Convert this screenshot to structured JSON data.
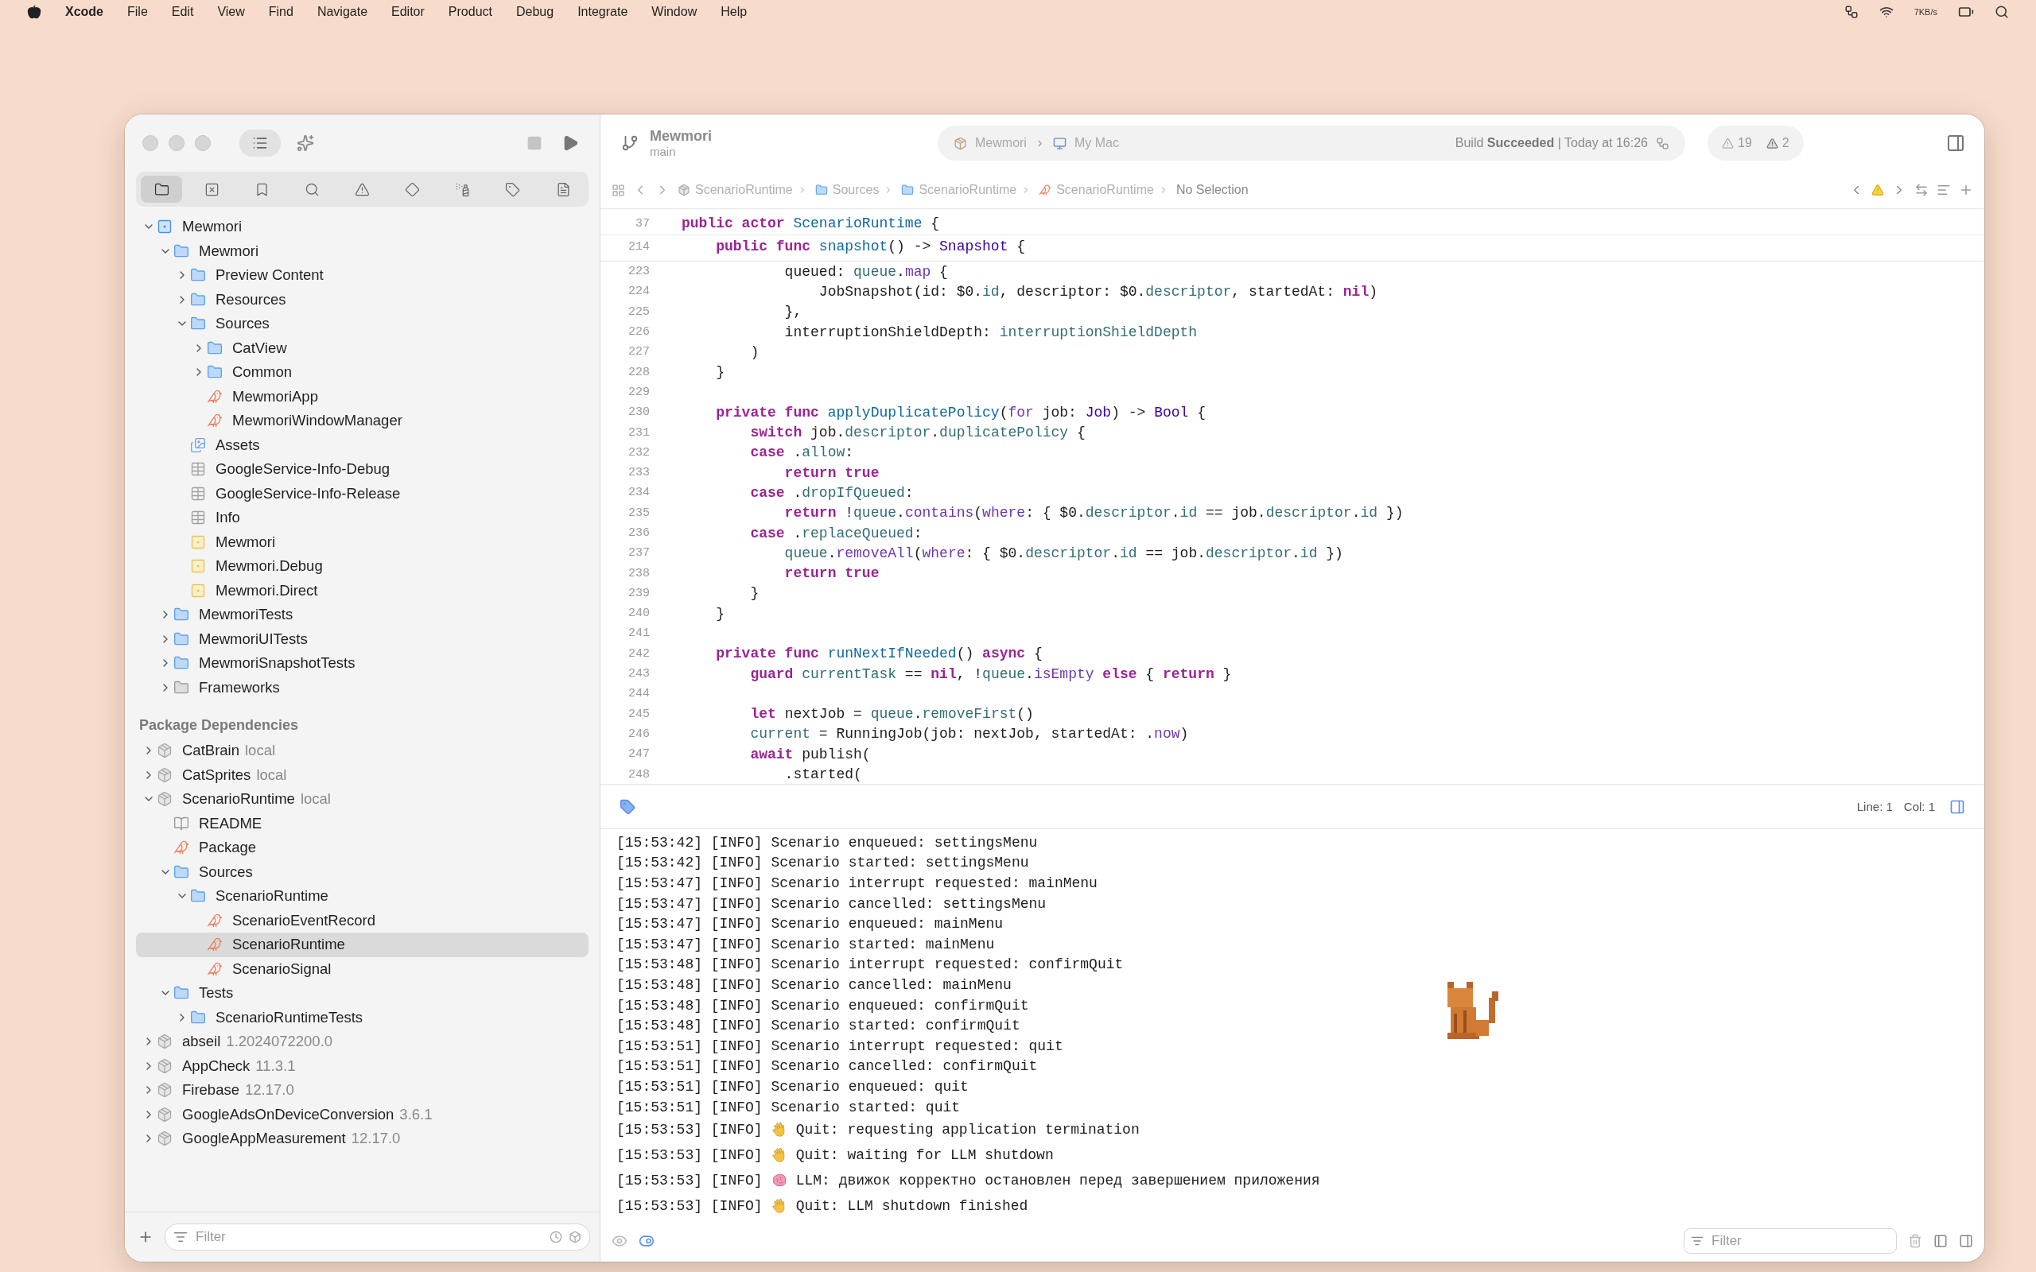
{
  "menu_bar": {
    "app": "Xcode",
    "menus": [
      "File",
      "Edit",
      "View",
      "Find",
      "Navigate",
      "Editor",
      "Product",
      "Debug",
      "Integrate",
      "Window",
      "Help"
    ],
    "network_speed": "7KB/s"
  },
  "toolbar": {
    "scheme": {
      "name": "Mewmori",
      "branch": "main"
    },
    "run_destination": {
      "target": "Mewmori",
      "device": "My Mac"
    },
    "status": "Build **Succeeded** | Today at 16:26",
    "warning_count": "19",
    "issue_count": "2"
  },
  "navigator": {
    "tabs": [
      {
        "kind": "folder",
        "selected": true
      },
      {
        "kind": "source-control",
        "selected": false
      },
      {
        "kind": "bookmark",
        "selected": false
      },
      {
        "kind": "search",
        "selected": false
      },
      {
        "kind": "issue",
        "selected": false
      },
      {
        "kind": "test",
        "selected": false
      },
      {
        "kind": "debug",
        "selected": false
      },
      {
        "kind": "breakpoint",
        "selected": false
      },
      {
        "kind": "report",
        "selected": false
      }
    ],
    "tree": [
      {
        "label": "Mewmori",
        "kind": "project",
        "expanded": true,
        "selected": false,
        "children": [
          {
            "label": "Mewmori",
            "kind": "folder",
            "expanded": true,
            "selected": false,
            "children": [
              {
                "label": "Preview Content",
                "kind": "folder",
                "expanded": false,
                "selected": false
              },
              {
                "label": "Resources",
                "kind": "folder",
                "expanded": false,
                "selected": false
              },
              {
                "label": "Sources",
                "kind": "folder",
                "expanded": true,
                "selected": false,
                "children": [
                  {
                    "label": "CatView",
                    "kind": "folder",
                    "expanded": false,
                    "selected": false
                  },
                  {
                    "label": "Common",
                    "kind": "folder",
                    "expanded": false,
                    "selected": false
                  },
                  {
                    "label": "MewmoriApp",
                    "kind": "swift",
                    "selected": false
                  },
                  {
                    "label": "MewmoriWindowManager",
                    "kind": "swift",
                    "selected": false
                  }
                ]
              },
              {
                "label": "Assets",
                "kind": "assets",
                "selected": false
              },
              {
                "label": "GoogleService-Info-Debug",
                "kind": "plist",
                "selected": false
              },
              {
                "label": "GoogleService-Info-Release",
                "kind": "plist",
                "selected": false
              },
              {
                "label": "Info",
                "kind": "plist",
                "selected": false
              },
              {
                "label": "Mewmori",
                "kind": "config",
                "selected": false
              },
              {
                "label": "Mewmori.Debug",
                "kind": "config",
                "selected": false
              },
              {
                "label": "Mewmori.Direct",
                "kind": "config",
                "selected": false
              }
            ]
          },
          {
            "label": "MewmoriTests",
            "kind": "folder",
            "expanded": false,
            "selected": false
          },
          {
            "label": "MewmoriUITests",
            "kind": "folder",
            "expanded": false,
            "selected": false
          },
          {
            "label": "MewmoriSnapshotTests",
            "kind": "folder",
            "expanded": false,
            "selected": false
          },
          {
            "label": "Frameworks",
            "kind": "frameworks",
            "expanded": false,
            "selected": false
          }
        ]
      }
    ],
    "packages_heading": "Package Dependencies",
    "packages": [
      {
        "label": "CatBrain",
        "suffix": "local",
        "kind": "package",
        "expanded": false,
        "selected": false
      },
      {
        "label": "CatSprites",
        "suffix": "local",
        "kind": "package",
        "expanded": false,
        "selected": false
      },
      {
        "label": "ScenarioRuntime",
        "suffix": "local",
        "kind": "package",
        "expanded": true,
        "selected": false,
        "children": [
          {
            "label": "README",
            "kind": "book",
            "selected": false
          },
          {
            "label": "Package",
            "kind": "swift",
            "selected": false
          },
          {
            "label": "Sources",
            "kind": "folder",
            "expanded": true,
            "selected": false,
            "children": [
              {
                "label": "ScenarioRuntime",
                "kind": "folder",
                "expanded": true,
                "selected": false,
                "children": [
                  {
                    "label": "ScenarioEventRecord",
                    "kind": "swift",
                    "selected": false
                  },
                  {
                    "label": "ScenarioRuntime",
                    "kind": "swift",
                    "selected": true
                  },
                  {
                    "label": "ScenarioSignal",
                    "kind": "swift",
                    "selected": false
                  }
                ]
              }
            ]
          },
          {
            "label": "Tests",
            "kind": "folder",
            "expanded": true,
            "selected": false,
            "children": [
              {
                "label": "ScenarioRuntimeTests",
                "kind": "folder",
                "expanded": false,
                "selected": false
              }
            ]
          }
        ]
      },
      {
        "label": "abseil",
        "suffix": "1.2024072200.0",
        "kind": "package",
        "expanded": false,
        "selected": false
      },
      {
        "label": "AppCheck",
        "suffix": "11.3.1",
        "kind": "package",
        "expanded": false,
        "selected": false
      },
      {
        "label": "Firebase",
        "suffix": "12.17.0",
        "kind": "package",
        "expanded": false,
        "selected": false
      },
      {
        "label": "GoogleAdsOnDeviceConversion",
        "suffix": "3.6.1",
        "kind": "package",
        "expanded": false,
        "selected": false
      },
      {
        "label": "GoogleAppMeasurement",
        "suffix": "12.17.0",
        "kind": "package",
        "expanded": false,
        "selected": false
      }
    ],
    "filter": {
      "placeholder": "Filter"
    }
  },
  "jump_bar": {
    "path": [
      {
        "label": "ScenarioRuntime",
        "kind": "package"
      },
      {
        "label": "Sources",
        "kind": "folder"
      },
      {
        "label": "ScenarioRuntime",
        "kind": "folder"
      },
      {
        "label": "ScenarioRuntime",
        "kind": "swift"
      }
    ],
    "selection": "No Selection"
  },
  "editor": {
    "sticky_lines": [
      {
        "number": "37",
        "tokens": [
          {
            "text": "public actor ",
            "kind": "keyword"
          },
          {
            "text": "ScenarioRuntime",
            "kind": "name"
          },
          {
            "text": " {",
            "kind": "plain"
          }
        ]
      },
      {
        "number": "214",
        "tokens": [
          {
            "text": "    public func ",
            "kind": "keyword"
          },
          {
            "text": "snapshot",
            "kind": "name"
          },
          {
            "text": "() -> ",
            "kind": "plain"
          },
          {
            "text": "Snapshot",
            "kind": "type"
          },
          {
            "text": " {",
            "kind": "plain"
          }
        ]
      }
    ],
    "lines": [
      {
        "number": "223",
        "tokens": [
          {
            "text": "            queued: ",
            "kind": "plain"
          },
          {
            "text": "queue",
            "kind": "property"
          },
          {
            "text": ".",
            "kind": "plain"
          },
          {
            "text": "map",
            "kind": "method"
          },
          {
            "text": " {",
            "kind": "plain"
          }
        ]
      },
      {
        "number": "224",
        "tokens": [
          {
            "text": "                JobSnapshot(id: $0.",
            "kind": "plain"
          },
          {
            "text": "id",
            "kind": "property"
          },
          {
            "text": ", descriptor: $0.",
            "kind": "plain"
          },
          {
            "text": "descriptor",
            "kind": "property"
          },
          {
            "text": ", startedAt: ",
            "kind": "plain"
          },
          {
            "text": "nil",
            "kind": "keyword"
          },
          {
            "text": ")",
            "kind": "plain"
          }
        ]
      },
      {
        "number": "225",
        "tokens": [
          {
            "text": "            },",
            "kind": "plain"
          }
        ]
      },
      {
        "number": "226",
        "tokens": [
          {
            "text": "            interruptionShieldDepth: ",
            "kind": "plain"
          },
          {
            "text": "interruptionShieldDepth",
            "kind": "property"
          }
        ]
      },
      {
        "number": "227",
        "tokens": [
          {
            "text": "        )",
            "kind": "plain"
          }
        ]
      },
      {
        "number": "228",
        "tokens": [
          {
            "text": "    }",
            "kind": "plain"
          }
        ]
      },
      {
        "number": "229"
      },
      {
        "number": "230",
        "tokens": [
          {
            "text": "    private func ",
            "kind": "keyword"
          },
          {
            "text": "applyDuplicatePolicy",
            "kind": "name"
          },
          {
            "text": "(",
            "kind": "plain"
          },
          {
            "text": "for",
            "kind": "method"
          },
          {
            "text": " job: ",
            "kind": "plain"
          },
          {
            "text": "Job",
            "kind": "type"
          },
          {
            "text": ") -> ",
            "kind": "plain"
          },
          {
            "text": "Bool",
            "kind": "type"
          },
          {
            "text": " {",
            "kind": "plain"
          }
        ]
      },
      {
        "number": "231",
        "tokens": [
          {
            "text": "        switch",
            "kind": "keyword"
          },
          {
            "text": " job.",
            "kind": "plain"
          },
          {
            "text": "descriptor",
            "kind": "property"
          },
          {
            "text": ".",
            "kind": "plain"
          },
          {
            "text": "duplicatePolicy",
            "kind": "property"
          },
          {
            "text": " {",
            "kind": "plain"
          }
        ]
      },
      {
        "number": "232",
        "tokens": [
          {
            "text": "        case",
            "kind": "keyword"
          },
          {
            "text": " .",
            "kind": "plain"
          },
          {
            "text": "allow",
            "kind": "property"
          },
          {
            "text": ":",
            "kind": "plain"
          }
        ]
      },
      {
        "number": "233",
        "tokens": [
          {
            "text": "            return true",
            "kind": "keyword"
          }
        ]
      },
      {
        "number": "234",
        "tokens": [
          {
            "text": "        case",
            "kind": "keyword"
          },
          {
            "text": " .",
            "kind": "plain"
          },
          {
            "text": "dropIfQueued",
            "kind": "property"
          },
          {
            "text": ":",
            "kind": "plain"
          }
        ]
      },
      {
        "number": "235",
        "tokens": [
          {
            "text": "            return",
            "kind": "keyword"
          },
          {
            "text": " !",
            "kind": "plain"
          },
          {
            "text": "queue",
            "kind": "property"
          },
          {
            "text": ".",
            "kind": "plain"
          },
          {
            "text": "contains",
            "kind": "method"
          },
          {
            "text": "(",
            "kind": "plain"
          },
          {
            "text": "where",
            "kind": "method"
          },
          {
            "text": ": { $0.",
            "kind": "plain"
          },
          {
            "text": "descriptor",
            "kind": "property"
          },
          {
            "text": ".",
            "kind": "plain"
          },
          {
            "text": "id",
            "kind": "property"
          },
          {
            "text": " == job.",
            "kind": "plain"
          },
          {
            "text": "descriptor",
            "kind": "property"
          },
          {
            "text": ".",
            "kind": "plain"
          },
          {
            "text": "id",
            "kind": "property"
          },
          {
            "text": " })",
            "kind": "plain"
          }
        ]
      },
      {
        "number": "236",
        "tokens": [
          {
            "text": "        case",
            "kind": "keyword"
          },
          {
            "text": " .",
            "kind": "plain"
          },
          {
            "text": "replaceQueued",
            "kind": "property"
          },
          {
            "text": ":",
            "kind": "plain"
          }
        ]
      },
      {
        "number": "237",
        "tokens": [
          {
            "text": "            queue",
            "kind": "property"
          },
          {
            "text": ".",
            "kind": "plain"
          },
          {
            "text": "removeAll",
            "kind": "method"
          },
          {
            "text": "(",
            "kind": "plain"
          },
          {
            "text": "where",
            "kind": "method"
          },
          {
            "text": ": { $0.",
            "kind": "plain"
          },
          {
            "text": "descriptor",
            "kind": "property"
          },
          {
            "text": ".",
            "kind": "plain"
          },
          {
            "text": "id",
            "kind": "property"
          },
          {
            "text": " == job.",
            "kind": "plain"
          },
          {
            "text": "descriptor",
            "kind": "property"
          },
          {
            "text": ".",
            "kind": "plain"
          },
          {
            "text": "id",
            "kind": "property"
          },
          {
            "text": " })",
            "kind": "plain"
          }
        ]
      },
      {
        "number": "238",
        "tokens": [
          {
            "text": "            return true",
            "kind": "keyword"
          }
        ]
      },
      {
        "number": "239",
        "tokens": [
          {
            "text": "        }",
            "kind": "plain"
          }
        ]
      },
      {
        "number": "240",
        "tokens": [
          {
            "text": "    }",
            "kind": "plain"
          }
        ]
      },
      {
        "number": "241"
      },
      {
        "number": "242",
        "tokens": [
          {
            "text": "    private func ",
            "kind": "keyword"
          },
          {
            "text": "runNextIfNeeded",
            "kind": "name"
          },
          {
            "text": "() ",
            "kind": "plain"
          },
          {
            "text": "async",
            "kind": "keyword"
          },
          {
            "text": " {",
            "kind": "plain"
          }
        ]
      },
      {
        "number": "243",
        "tokens": [
          {
            "text": "        guard ",
            "kind": "keyword"
          },
          {
            "text": "currentTask",
            "kind": "property"
          },
          {
            "text": " == ",
            "kind": "plain"
          },
          {
            "text": "nil",
            "kind": "keyword"
          },
          {
            "text": ", !",
            "kind": "plain"
          },
          {
            "text": "queue",
            "kind": "property"
          },
          {
            "text": ".",
            "kind": "plain"
          },
          {
            "text": "isEmpty",
            "kind": "method"
          },
          {
            "text": " else",
            "kind": "keyword"
          },
          {
            "text": " { ",
            "kind": "plain"
          },
          {
            "text": "return",
            "kind": "keyword"
          },
          {
            "text": " }",
            "kind": "plain"
          }
        ]
      },
      {
        "number": "244"
      },
      {
        "number": "245",
        "tokens": [
          {
            "text": "        let ",
            "kind": "keyword"
          },
          {
            "text": "nextJob = ",
            "kind": "plain"
          },
          {
            "text": "queue",
            "kind": "property"
          },
          {
            "text": ".",
            "kind": "plain"
          },
          {
            "text": "removeFirst",
            "kind": "property"
          },
          {
            "text": "()",
            "kind": "plain"
          }
        ]
      },
      {
        "number": "246",
        "tokens": [
          {
            "text": "        current",
            "kind": "property"
          },
          {
            "text": " = RunningJob(job: nextJob, startedAt: .",
            "kind": "plain"
          },
          {
            "text": "now",
            "kind": "method"
          },
          {
            "text": ")",
            "kind": "plain"
          }
        ]
      },
      {
        "number": "247",
        "tokens": [
          {
            "text": "        await ",
            "kind": "keyword"
          },
          {
            "text": "publish(",
            "kind": "plain"
          }
        ]
      },
      {
        "number": "248",
        "tokens": [
          {
            "text": "            .started(",
            "kind": "plain"
          }
        ]
      }
    ]
  },
  "debug_bar": {
    "line": "Line: 1",
    "column": "Col: 1"
  },
  "console": {
    "lines": [
      {
        "kind": "log",
        "text": "[15:53:42] [INFO] Scenario enqueued: settingsMenu"
      },
      {
        "kind": "log",
        "text": "[15:53:42] [INFO] Scenario started: settingsMenu"
      },
      {
        "kind": "log",
        "text": "[15:53:47] [INFO] Scenario interrupt requested: mainMenu"
      },
      {
        "kind": "log",
        "text": "[15:53:47] [INFO] Scenario cancelled: settingsMenu"
      },
      {
        "kind": "log",
        "text": "[15:53:47] [INFO] Scenario enqueued: mainMenu"
      },
      {
        "kind": "log",
        "text": "[15:53:47] [INFO] Scenario started: mainMenu"
      },
      {
        "kind": "log",
        "text": "[15:53:48] [INFO] Scenario interrupt requested: confirmQuit"
      },
      {
        "kind": "log",
        "text": "[15:53:48] [INFO] Scenario cancelled: mainMenu"
      },
      {
        "kind": "log",
        "text": "[15:53:48] [INFO] Scenario enqueued: confirmQuit"
      },
      {
        "kind": "log",
        "text": "[15:53:48] [INFO] Scenario started: confirmQuit"
      },
      {
        "kind": "log",
        "text": "[15:53:51] [INFO] Scenario interrupt requested: quit"
      },
      {
        "kind": "log",
        "text": "[15:53:51] [INFO] Scenario cancelled: confirmQuit"
      },
      {
        "kind": "log",
        "text": "[15:53:51] [INFO] Scenario enqueued: quit"
      },
      {
        "kind": "log",
        "text": "[15:53:51] [INFO] Scenario started: quit"
      },
      {
        "kind": "wave",
        "prefix": "[15:53:53] [INFO]",
        "message": "Quit: requesting application termination"
      },
      {
        "kind": "wave",
        "prefix": "[15:53:53] [INFO]",
        "message": "Quit: waiting for LLM shutdown"
      },
      {
        "kind": "brain",
        "prefix": "[15:53:53] [INFO]",
        "message": "LLM: движок корректно остановлен перед завершением приложения"
      },
      {
        "kind": "wave",
        "prefix": "[15:53:53] [INFO]",
        "message": "Quit: LLM shutdown finished"
      }
    ],
    "filter": {
      "placeholder": "Filter"
    }
  }
}
